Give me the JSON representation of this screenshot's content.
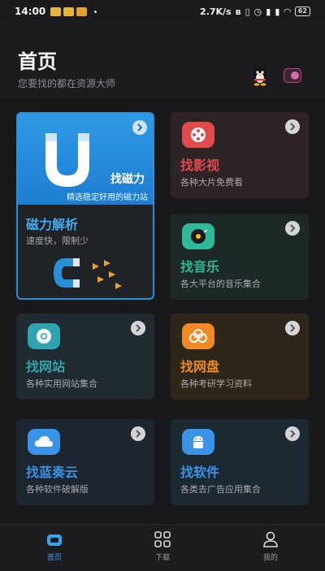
{
  "status_bar": {
    "time": "14:00",
    "net_speed": "2.7K/s",
    "battery": "62"
  },
  "header": {
    "title": "首页",
    "subtitle": "您要找的都在资源大师",
    "qq_icon": "qq-penguin-icon",
    "toggle_icon": "switch-icon"
  },
  "cards": {
    "magnet": {
      "banner_title": "找磁力",
      "banner_subtitle": "精选稳定好用的磁力站",
      "title": "磁力解析",
      "desc": "速度快，限制少",
      "color": "#44a8f0"
    },
    "video": {
      "title": "找影视",
      "desc": "各种大片免费看",
      "color": "#e24b4b"
    },
    "music": {
      "title": "找音乐",
      "desc": "各大平台的音乐集合",
      "color": "#2fb89a"
    },
    "site": {
      "title": "找网站",
      "desc": "各种实用网站集合",
      "color": "#2fa3b0"
    },
    "disk": {
      "title": "找网盘",
      "desc": "各种考研学习资料",
      "color": "#f08a24"
    },
    "lanzou": {
      "title": "找蓝奏云",
      "desc": "各种软件破解版",
      "color": "#3a93e6"
    },
    "soft": {
      "title": "找软件",
      "desc": "各类去广告应用集合",
      "color": "#3a93e6"
    }
  },
  "nav": {
    "home": "首页",
    "download": "下载",
    "mine": "我的",
    "active_color": "#3aa0f0"
  }
}
